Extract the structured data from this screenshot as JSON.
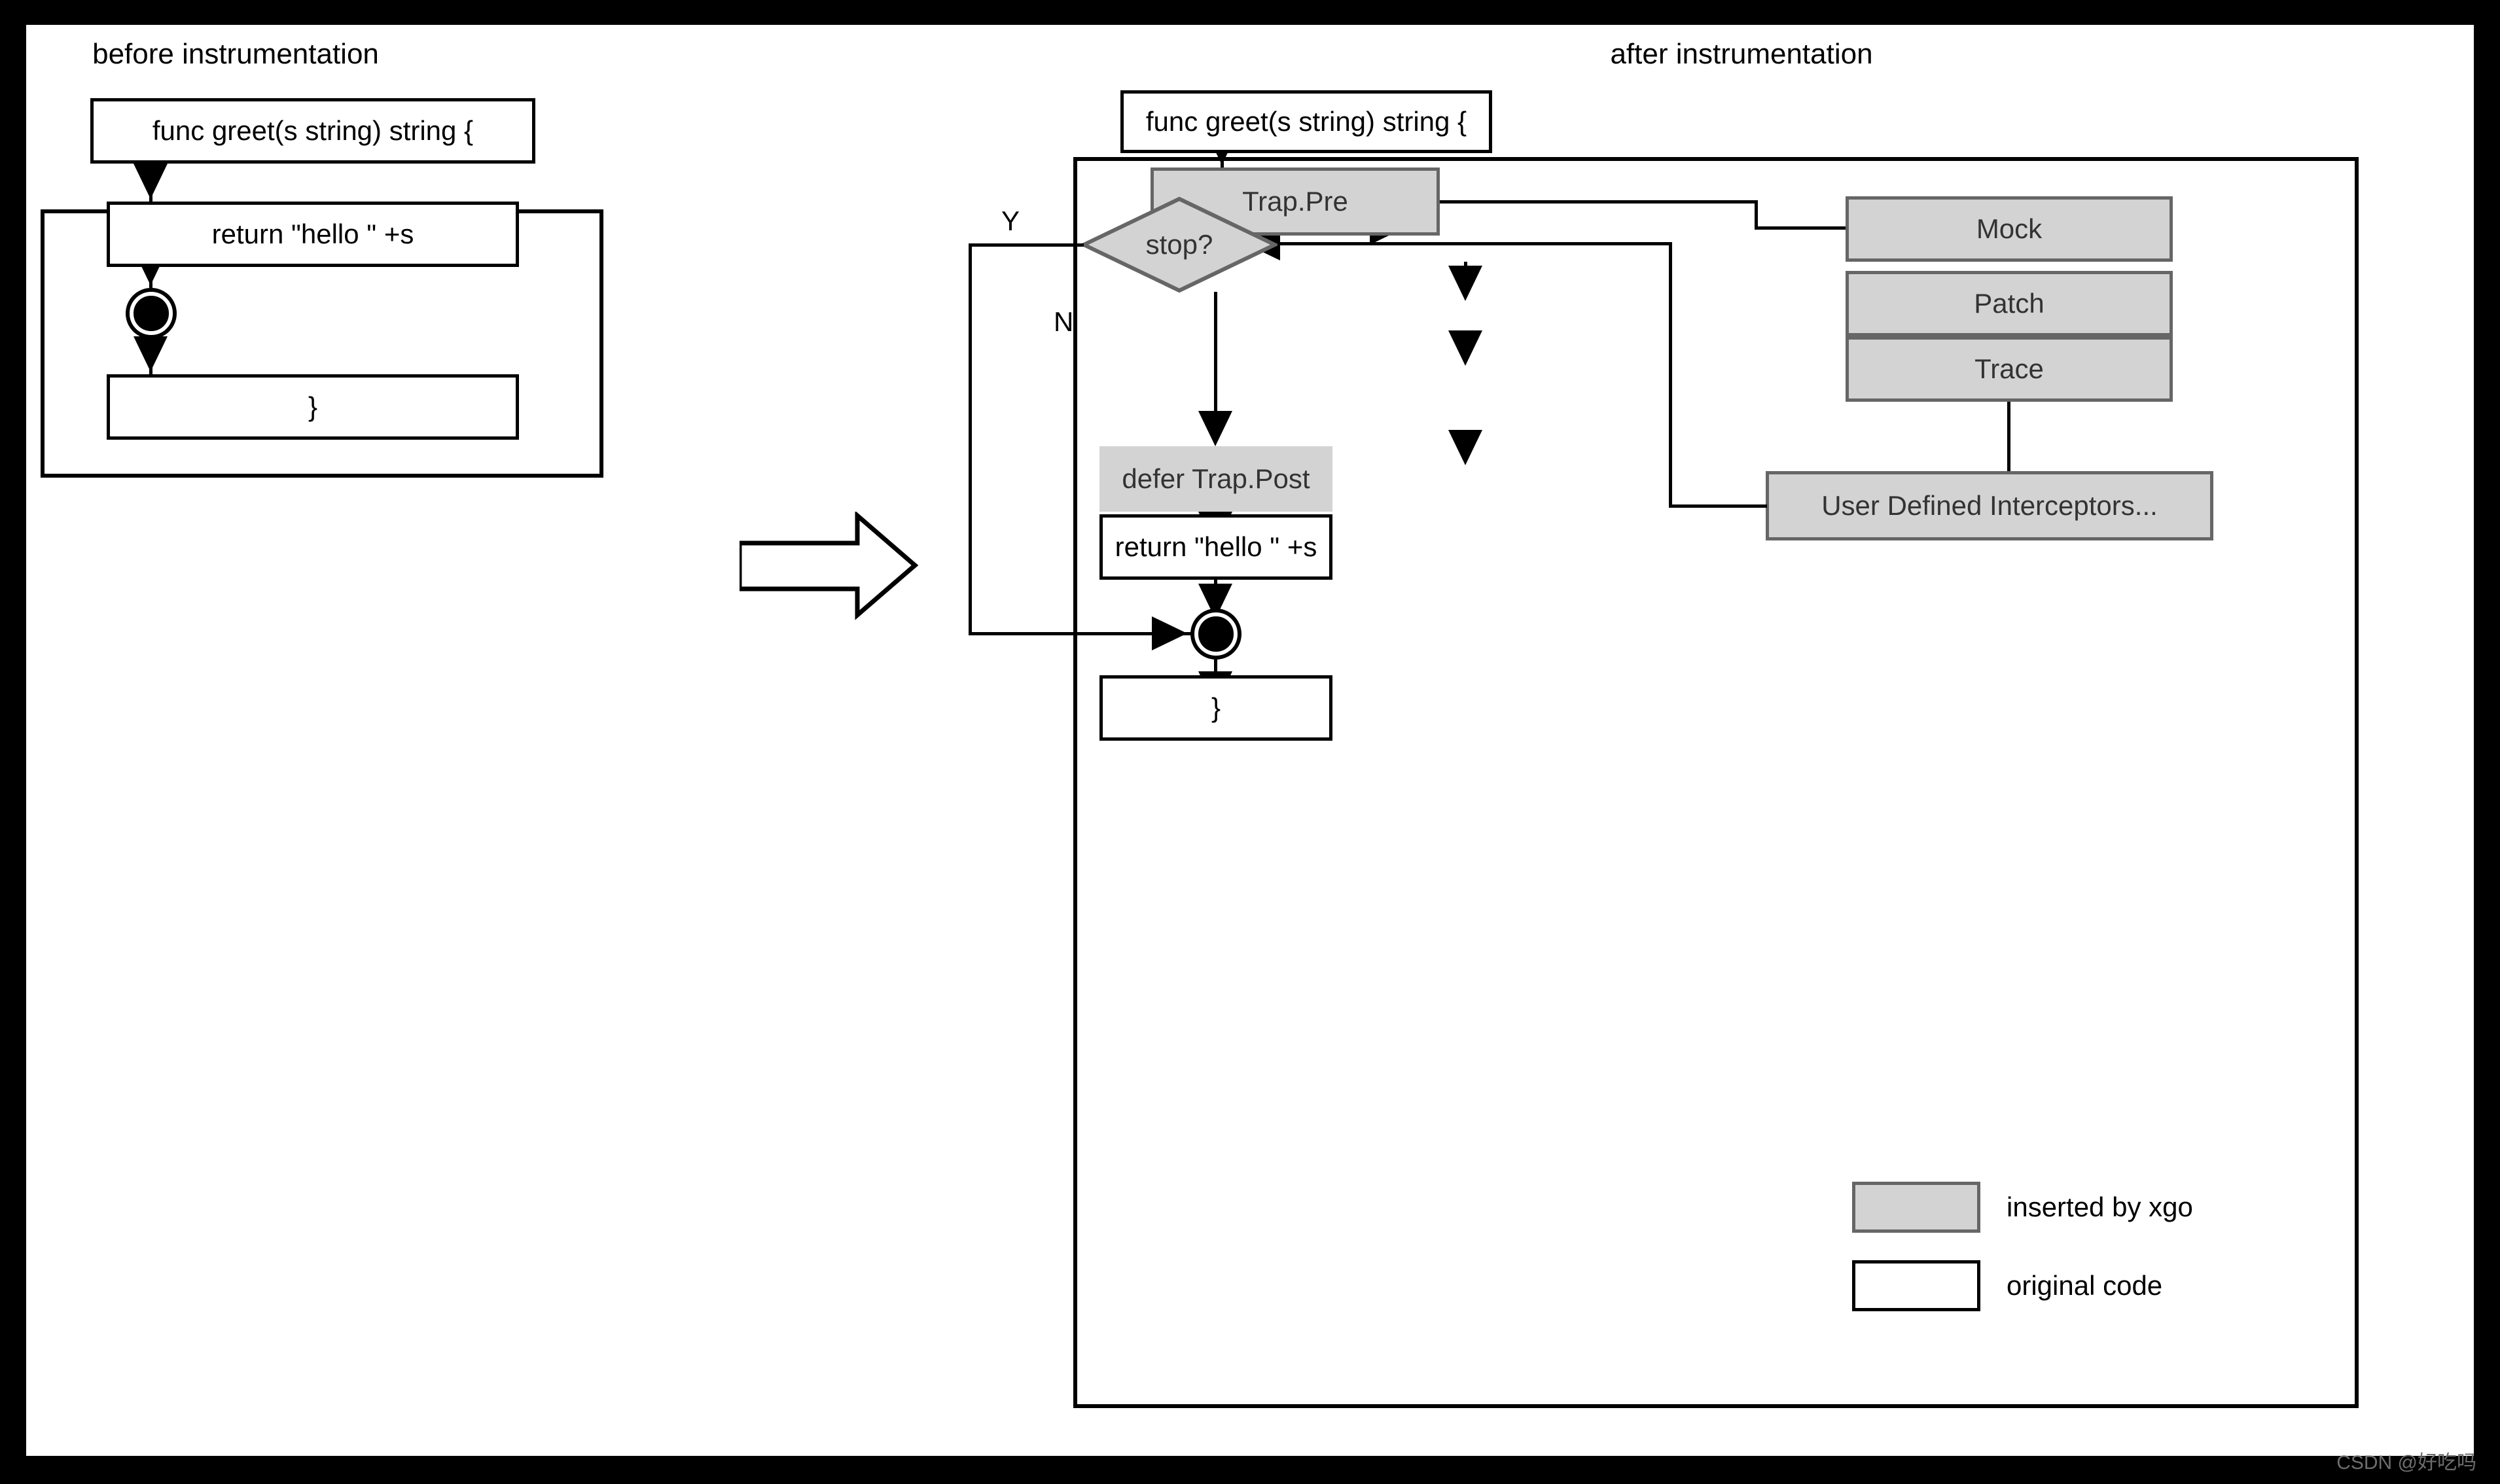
{
  "titles": {
    "before": "before instrumentation",
    "after": "after instrumentation"
  },
  "before_panel": {
    "nodes": [
      {
        "id": "func-decl",
        "label": "func greet(s string) string {",
        "kind": "original"
      },
      {
        "id": "return-stmt",
        "label": "return \"hello \" +s",
        "kind": "original"
      },
      {
        "id": "final-state",
        "label": "",
        "kind": "final-state"
      },
      {
        "id": "closing-brace",
        "label": "}",
        "kind": "original"
      }
    ]
  },
  "after_panel": {
    "nodes": [
      {
        "id": "func-decl",
        "label": "func greet(s string) string {",
        "kind": "original"
      },
      {
        "id": "trap-pre",
        "label": "Trap.Pre",
        "kind": "inserted"
      },
      {
        "id": "mock",
        "label": "Mock",
        "kind": "inserted"
      },
      {
        "id": "patch",
        "label": "Patch",
        "kind": "inserted"
      },
      {
        "id": "trace",
        "label": "Trace",
        "kind": "inserted"
      },
      {
        "id": "user-interceptors",
        "label": "User Defined Interceptors...",
        "kind": "inserted"
      },
      {
        "id": "stop-decision",
        "label": "stop?",
        "kind": "decision"
      },
      {
        "id": "defer-trap-post",
        "label": "defer Trap.Post",
        "kind": "inserted"
      },
      {
        "id": "return-stmt",
        "label": "return \"hello \" +s",
        "kind": "original"
      },
      {
        "id": "final-state",
        "label": "",
        "kind": "final-state"
      },
      {
        "id": "closing-brace",
        "label": "}",
        "kind": "original"
      }
    ],
    "edge_labels": {
      "yes": "Y",
      "no": "N"
    }
  },
  "legend": {
    "items": [
      {
        "swatch": "inserted",
        "label": "inserted by xgo"
      },
      {
        "swatch": "original",
        "label": "original code"
      }
    ]
  },
  "transform_arrow": {
    "name": "transform-arrow",
    "direction": "right"
  },
  "watermark": "CSDN @好吃吗",
  "colors": {
    "inserted_fill": "#d3d3d3",
    "inserted_stroke": "#666666",
    "original_fill": "#ffffff",
    "original_stroke": "#000000",
    "page_border": "#000000"
  }
}
